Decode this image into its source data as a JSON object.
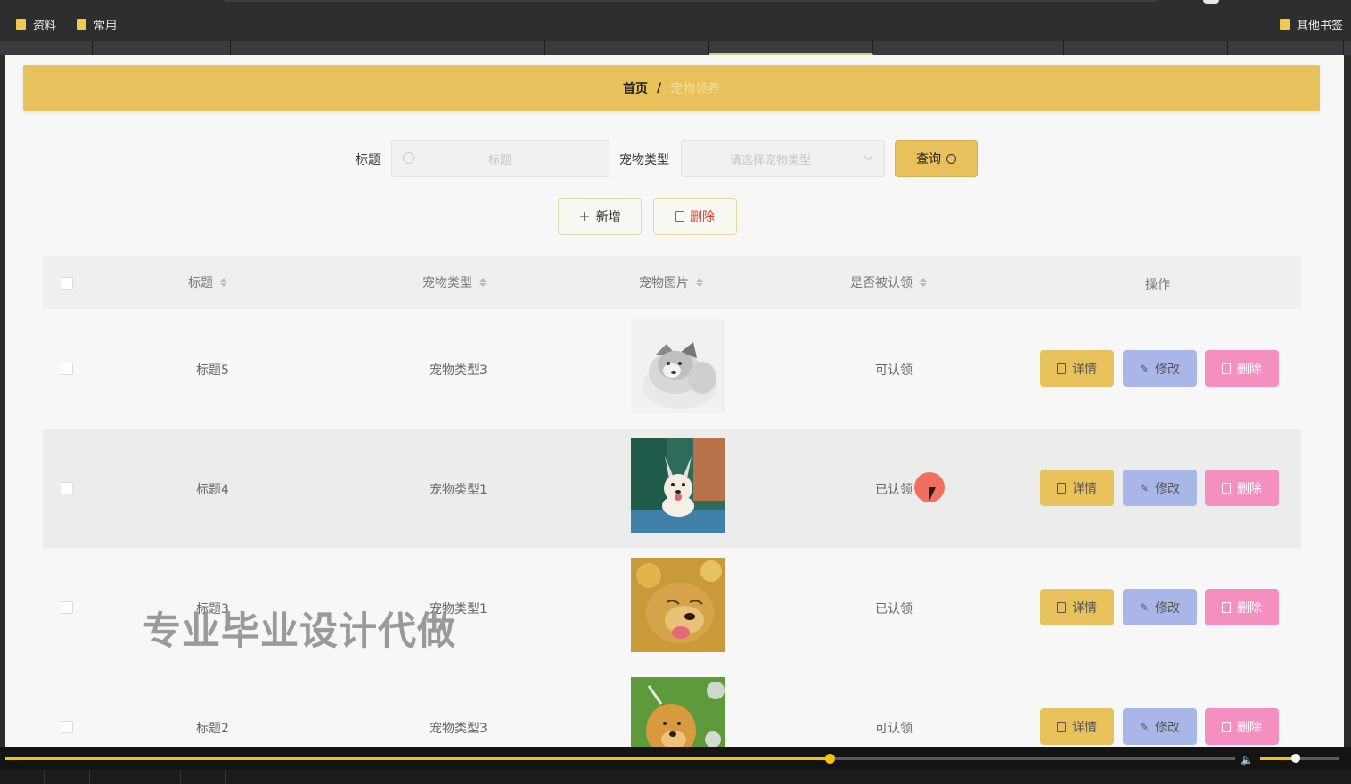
{
  "bookmarks": {
    "items": [
      {
        "label": "资料"
      },
      {
        "label": "常用"
      },
      {
        "label": "其他书签"
      }
    ]
  },
  "breadcrumb": {
    "home": "首页",
    "separator": "/",
    "current": "宠物领养"
  },
  "search": {
    "title_label": "标题",
    "title_placeholder": "标题",
    "type_label": "宠物类型",
    "type_placeholder": "请选择宠物类型",
    "query_label": "查询"
  },
  "toolbar": {
    "add_label": "新增",
    "delete_label": "删除"
  },
  "table": {
    "headers": {
      "title": "标题",
      "type": "宠物类型",
      "image": "宠物图片",
      "adopted": "是否被认领",
      "actions": "操作"
    },
    "rows": [
      {
        "title": "标题5",
        "type": "宠物类型3",
        "adopted": "可认领",
        "image": "husky-puppy"
      },
      {
        "title": "标题4",
        "type": "宠物类型1",
        "adopted": "已认领",
        "image": "corgi"
      },
      {
        "title": "标题3",
        "type": "宠物类型1",
        "adopted": "已认领",
        "image": "golden-retriever"
      },
      {
        "title": "标题2",
        "type": "宠物类型3",
        "adopted": "可认领",
        "image": "golden-on-grass"
      }
    ],
    "actions": {
      "detail": "详情",
      "edit": "修改",
      "remove": "删除"
    }
  },
  "watermark": "专业毕业设计代做",
  "player": {
    "progress": 0.67,
    "volume": 0.45
  },
  "colors": {
    "accent": "#e7c15b",
    "edit": "#a9b7e8",
    "remove": "#f58fbf",
    "danger": "#e0402f"
  }
}
